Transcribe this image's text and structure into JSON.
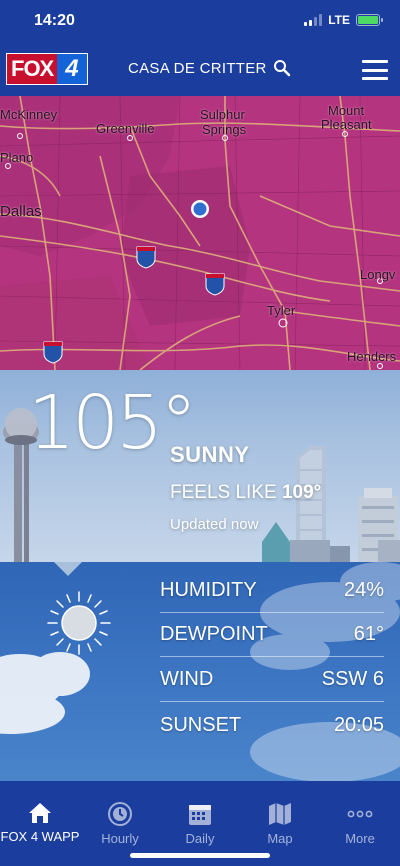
{
  "status_bar": {
    "time": "14:20",
    "network": "LTE"
  },
  "header": {
    "logo_fox": "FOX",
    "logo_number": "4",
    "location": "CASA DE CRITTER"
  },
  "map": {
    "cities": [
      {
        "name": "McKinney"
      },
      {
        "name": "Greenville"
      },
      {
        "name": "Sulphur"
      },
      {
        "name": "Springs"
      },
      {
        "name": "Mount"
      },
      {
        "name": "Pleasant"
      },
      {
        "name": "Plano"
      },
      {
        "name": "Dallas"
      },
      {
        "name": "Tyler"
      },
      {
        "name": "Longv"
      },
      {
        "name": "Henders"
      }
    ],
    "highways": [
      "20",
      "20",
      "45"
    ],
    "colors": {
      "fill": "#b4347f",
      "roads": "#d9a37a",
      "location": "#2f6fd0"
    }
  },
  "current": {
    "temperature": "105°",
    "condition": "SUNNY",
    "feels_like_label": "FEELS LIKE",
    "feels_like_value": "109°",
    "updated": "Updated now"
  },
  "details": [
    {
      "label": "HUMIDITY",
      "value": "24%"
    },
    {
      "label": "DEWPOINT",
      "value": "61°"
    },
    {
      "label": "WIND",
      "value": "SSW 6"
    },
    {
      "label": "SUNSET",
      "value": "20:05"
    }
  ],
  "nav": [
    {
      "label": "FOX 4 WAPP",
      "icon": "home-icon"
    },
    {
      "label": "Hourly",
      "icon": "clock-icon"
    },
    {
      "label": "Daily",
      "icon": "calendar-icon"
    },
    {
      "label": "Map",
      "icon": "map-icon"
    },
    {
      "label": "More",
      "icon": "more-icon"
    }
  ]
}
